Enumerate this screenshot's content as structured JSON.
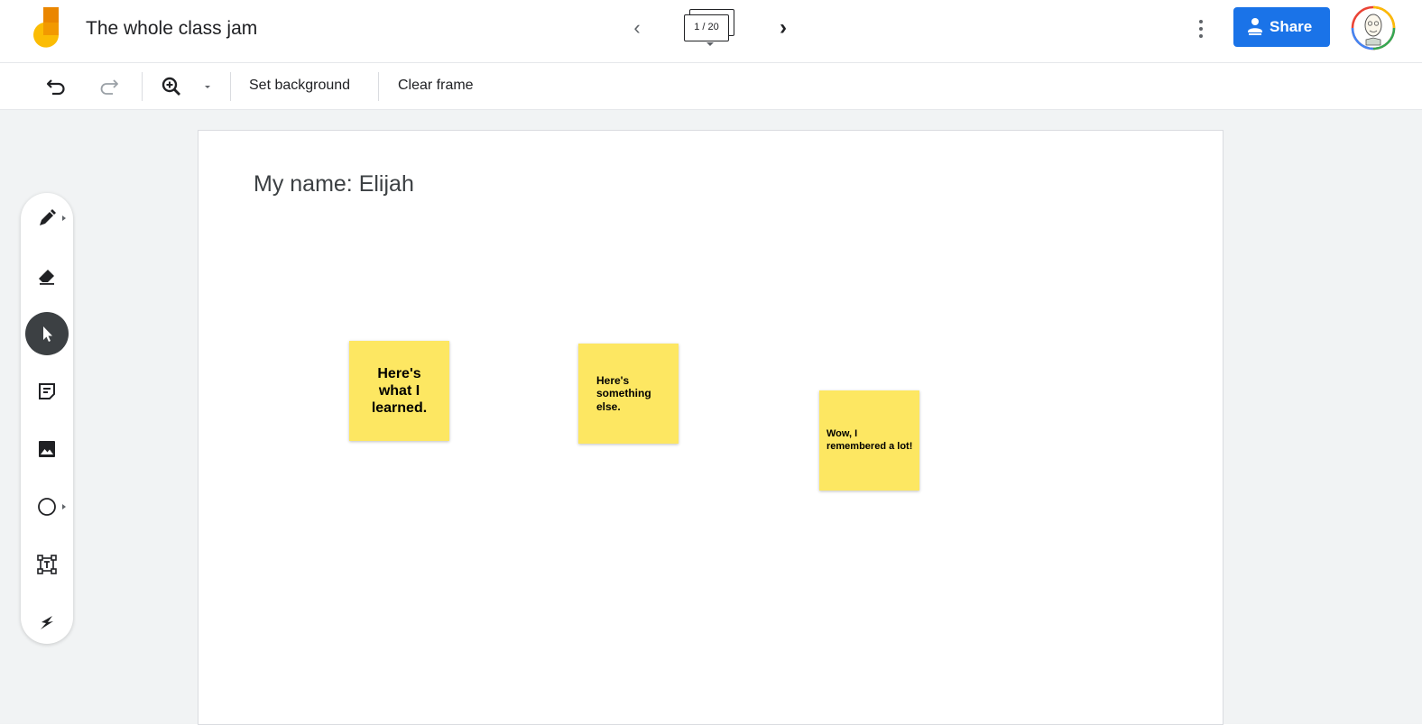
{
  "app": {
    "title": "The whole class jam"
  },
  "frames": {
    "counter": "1 / 20"
  },
  "header": {
    "share_label": "Share"
  },
  "toolbar": {
    "set_background_label": "Set background",
    "clear_frame_label": "Clear frame"
  },
  "canvas": {
    "text": "My name: Elijah",
    "stickies": [
      {
        "text": "Here's what I learned."
      },
      {
        "text": "Here's something else."
      },
      {
        "text": "Wow, I remembered a lot!"
      }
    ]
  },
  "tools": [
    {
      "icon": "pen-icon"
    },
    {
      "icon": "eraser-icon"
    },
    {
      "icon": "select-icon",
      "active": true
    },
    {
      "icon": "sticky-note-icon"
    },
    {
      "icon": "image-icon"
    },
    {
      "icon": "circle-icon"
    },
    {
      "icon": "text-box-icon"
    },
    {
      "icon": "laser-icon"
    }
  ],
  "colors": {
    "accent": "#1a73e8",
    "sticky": "#fde762",
    "workspace": "#f1f3f4"
  }
}
